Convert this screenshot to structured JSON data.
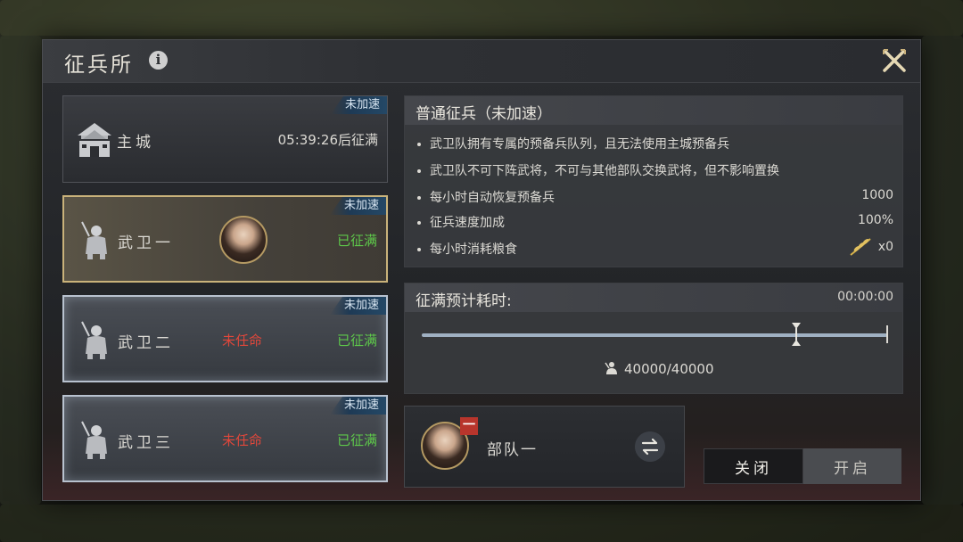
{
  "window": {
    "title": "征兵所"
  },
  "cards": [
    {
      "id": "main",
      "name": "主城",
      "badge": "未加速",
      "right": "05:39:26后征满",
      "mid": ""
    },
    {
      "id": "g1",
      "name": "武卫一",
      "badge": "未加速",
      "right": "已征满",
      "mid": ""
    },
    {
      "id": "g2",
      "name": "武卫二",
      "badge": "未加速",
      "right": "已征满",
      "mid": "未任命"
    },
    {
      "id": "g3",
      "name": "武卫三",
      "badge": "未加速",
      "right": "已征满",
      "mid": "未任命"
    }
  ],
  "info": {
    "title": "普通征兵（未加速）",
    "notes": [
      "武卫队拥有专属的预备兵队列，且无法使用主城预备兵",
      "武卫队不可下阵武将，不可与其他部队交换武将，但不影响置换"
    ],
    "stats": [
      {
        "label": "每小时自动恢复预备兵",
        "value": "1000"
      },
      {
        "label": "征兵速度加成",
        "value": "100%"
      },
      {
        "label": "每小时消耗粮食",
        "value": "x0"
      }
    ]
  },
  "time_panel": {
    "title": "征满预计耗时:",
    "timer": "00:00:00",
    "count": "40000/40000",
    "fill_fraction": 0.8
  },
  "troop": {
    "tag": "一",
    "name": "部队一"
  },
  "buttons": {
    "off": "关闭",
    "on": "开启"
  },
  "colors": {
    "accent_green": "#5ec94a",
    "accent_red": "#e0473b",
    "gold_border": "#c9b27a"
  }
}
